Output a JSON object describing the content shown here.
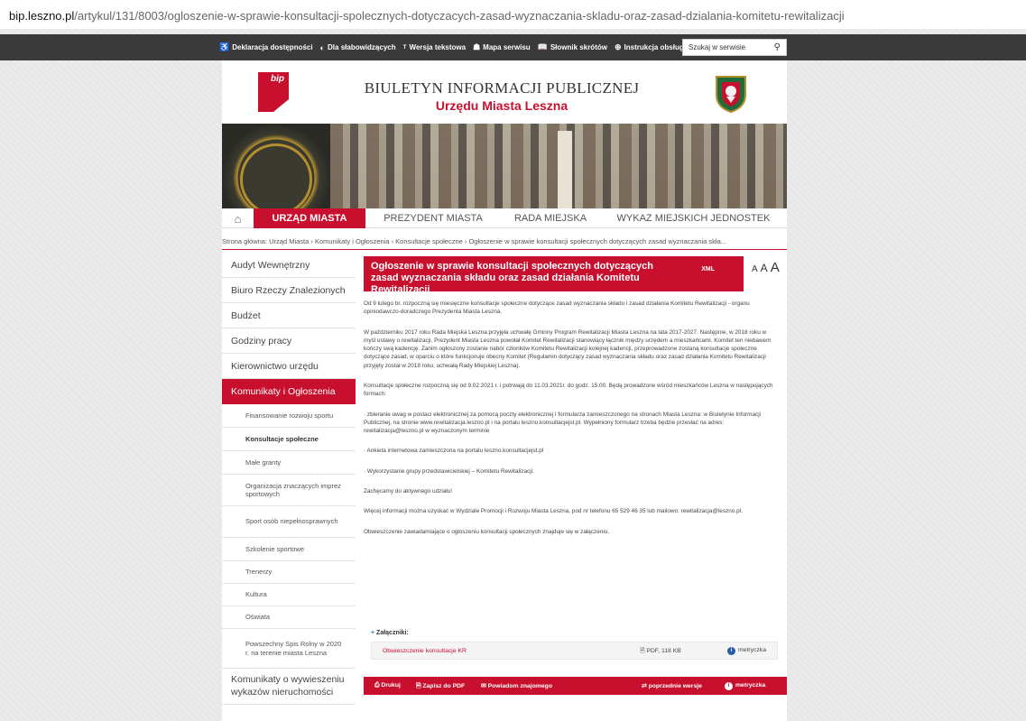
{
  "url": {
    "host": "bip.leszno.pl",
    "path": "/artykul/131/8003/ogloszenie-w-sprawie-konsultacji-spolecznych-dotyczacych-zasad-wyznaczania-skladu-oraz-zasad-dzialania-komitetu-rewitalizacji"
  },
  "topbar": {
    "links": [
      {
        "icon": "accessibility-icon",
        "glyph": "♿",
        "label": "Deklaracja dostępności"
      },
      {
        "icon": "contrast-icon",
        "glyph": "◐",
        "label": "Dla słabowidzących"
      },
      {
        "icon": "text-version-icon",
        "glyph": "ᵀ",
        "label": "Wersja tekstowa"
      },
      {
        "icon": "sitemap-icon",
        "glyph": "☗",
        "label": "Mapa serwisu"
      },
      {
        "icon": "glossary-icon",
        "glyph": "📖",
        "label": "Słownik skrótów"
      },
      {
        "icon": "help-icon",
        "glyph": "⊕",
        "label": "Instrukcja obsługi"
      }
    ],
    "search_placeholder": "Szukaj w serwisie"
  },
  "header": {
    "logo_text": "bip",
    "title_line1": "BIULETYN INFORMACJI PUBLICZNEJ",
    "title_line2": "Urzędu Miasta Leszna"
  },
  "nav": [
    {
      "label": "URZĄD MIASTA",
      "active": true
    },
    {
      "label": "PREZYDENT MIASTA",
      "active": false
    },
    {
      "label": "RADA MIEJSKA",
      "active": false
    },
    {
      "label": "WYKAZ MIEJSKICH JEDNOSTEK",
      "active": false
    }
  ],
  "breadcrumb": "Strona główna: Urząd Miasta › Komunikaty i Ogłoszenia › Konsultacje społeczne › Ogłoszenie w sprawie konsultacji społecznych dotyczących zasad wyznaczania skła...",
  "sidebar": {
    "top_items": [
      "Audyt Wewnętrzny",
      "Biuro Rzeczy Znalezionych",
      "Budżet",
      "Godziny pracy",
      "Kierownictwo urzędu"
    ],
    "active_item": "Komunikaty i Ogłoszenia",
    "sub_items": [
      "Finansowanie rozwoju sportu",
      "Konsultacje społeczne",
      "Małe granty",
      "Organizacja znaczących imprez sportowych",
      "Sport osób niepełnosprawnych",
      "Szkolenie sportowe",
      "Trenerzy",
      "Kultura",
      "Oświata",
      "Powszechny Spis Rolny w 2020 r. na terenie miasta Leszna"
    ],
    "bottom_item": "Komunikaty o wywieszeniu wykazów nieruchomości"
  },
  "article": {
    "title": "Ogłoszenie w sprawie konsultacji społecznych dotyczących zasad wyznaczania składu oraz zasad działania Komitetu Rewitalizacji",
    "xml": "XML",
    "font_sizes": [
      "A",
      "A",
      "A"
    ],
    "paragraphs": [
      "Od 9 lutego br. rozpoczną się miesięczne konsultacje społeczne dotyczące zasad wyznaczania składu i zasad działania Komitetu Rewitalizacji - organu opiniodawczo-doradczego Prezydenta Miasta Leszna.",
      "W październiku 2017 roku Rada Miejska Leszna przyjęła uchwałę Gminny Program Rewitalizacji Miasta Leszna na lata 2017-2027. Następnie, w 2018 roku w myśl ustawy o rewitalizacji, Prezydent Miasta Leszna powołał Komitet Rewitalizacji stanowiący łącznik między urzędem a mieszkańcami. Komitet ten niebawem kończy swą kadencję. Zanim ogłoszony zostanie nabór członków Komitetu Rewitalizacji kolejnej kadencji, przeprowadzone zostaną konsultacje społeczne dotyczące zasad, w oparciu o które funkcjonuje obecny Komitet (Regulamin dotyczący zasad wyznaczania składu oraz zasad działania Komitetu Rewitalizacji przyjęty został w 2018 roku, uchwałą Rady Miejskiej Leszna).",
      "Konsultacje społeczne rozpoczną się od 9.02.2021 r. i potrwają do 11.03.2021r. do godz. 15.00. Będą prowadzone wśród mieszkańców Leszna w następujących formach:",
      "·        zbieranie uwag w postaci elektronicznej za pomocą poczty elektronicznej i formularza zamieszczonego na stronach Miasta Leszna: w Biuletynie Informacji Publicznej, na stronie www.rewitalizacja.leszno.pl i na portalu leszno.konsultacjejst.pl. Wypełniony formularz trzeba będzie przesłać na adres: rewitalizacja@leszno.pl w wyznaczonym terminie",
      "·        Ankieta internetowa zamieszczona na portalu leszno.konsultacjejst.pl",
      "·        Wykorzystanie grupy przedstawicielskiej – Komitetu Rewitalizacji.",
      "Zachęcamy do aktywnego udziału!",
      "Więcej informacji można uzyskać w Wydziale Promocji i Rozwoju Miasta Leszna, pod nr telefonu 65 529 46 35 lub mailowo: rewitalizacja@leszno.pl.",
      "Obwieszczenie zawiadamiające o ogłoszeniu konsultacji społecznych znajduje się w załączeniu."
    ]
  },
  "attachments": {
    "label": "Załączniki:",
    "file_name": "Obwieszczenie konsultacje KR",
    "file_meta": "PDF, 118 KB",
    "metryczka": "metryczka"
  },
  "footer": {
    "print": "Drukuj",
    "save_pdf": "Zapisz do PDF",
    "notify": "Powiadom znajomego",
    "versions": "poprzednie wersje",
    "metryczka": "metryczka"
  },
  "colors": {
    "accent": "#c8102e",
    "topbar": "#3a3a3a",
    "background": "#ebebeb"
  }
}
